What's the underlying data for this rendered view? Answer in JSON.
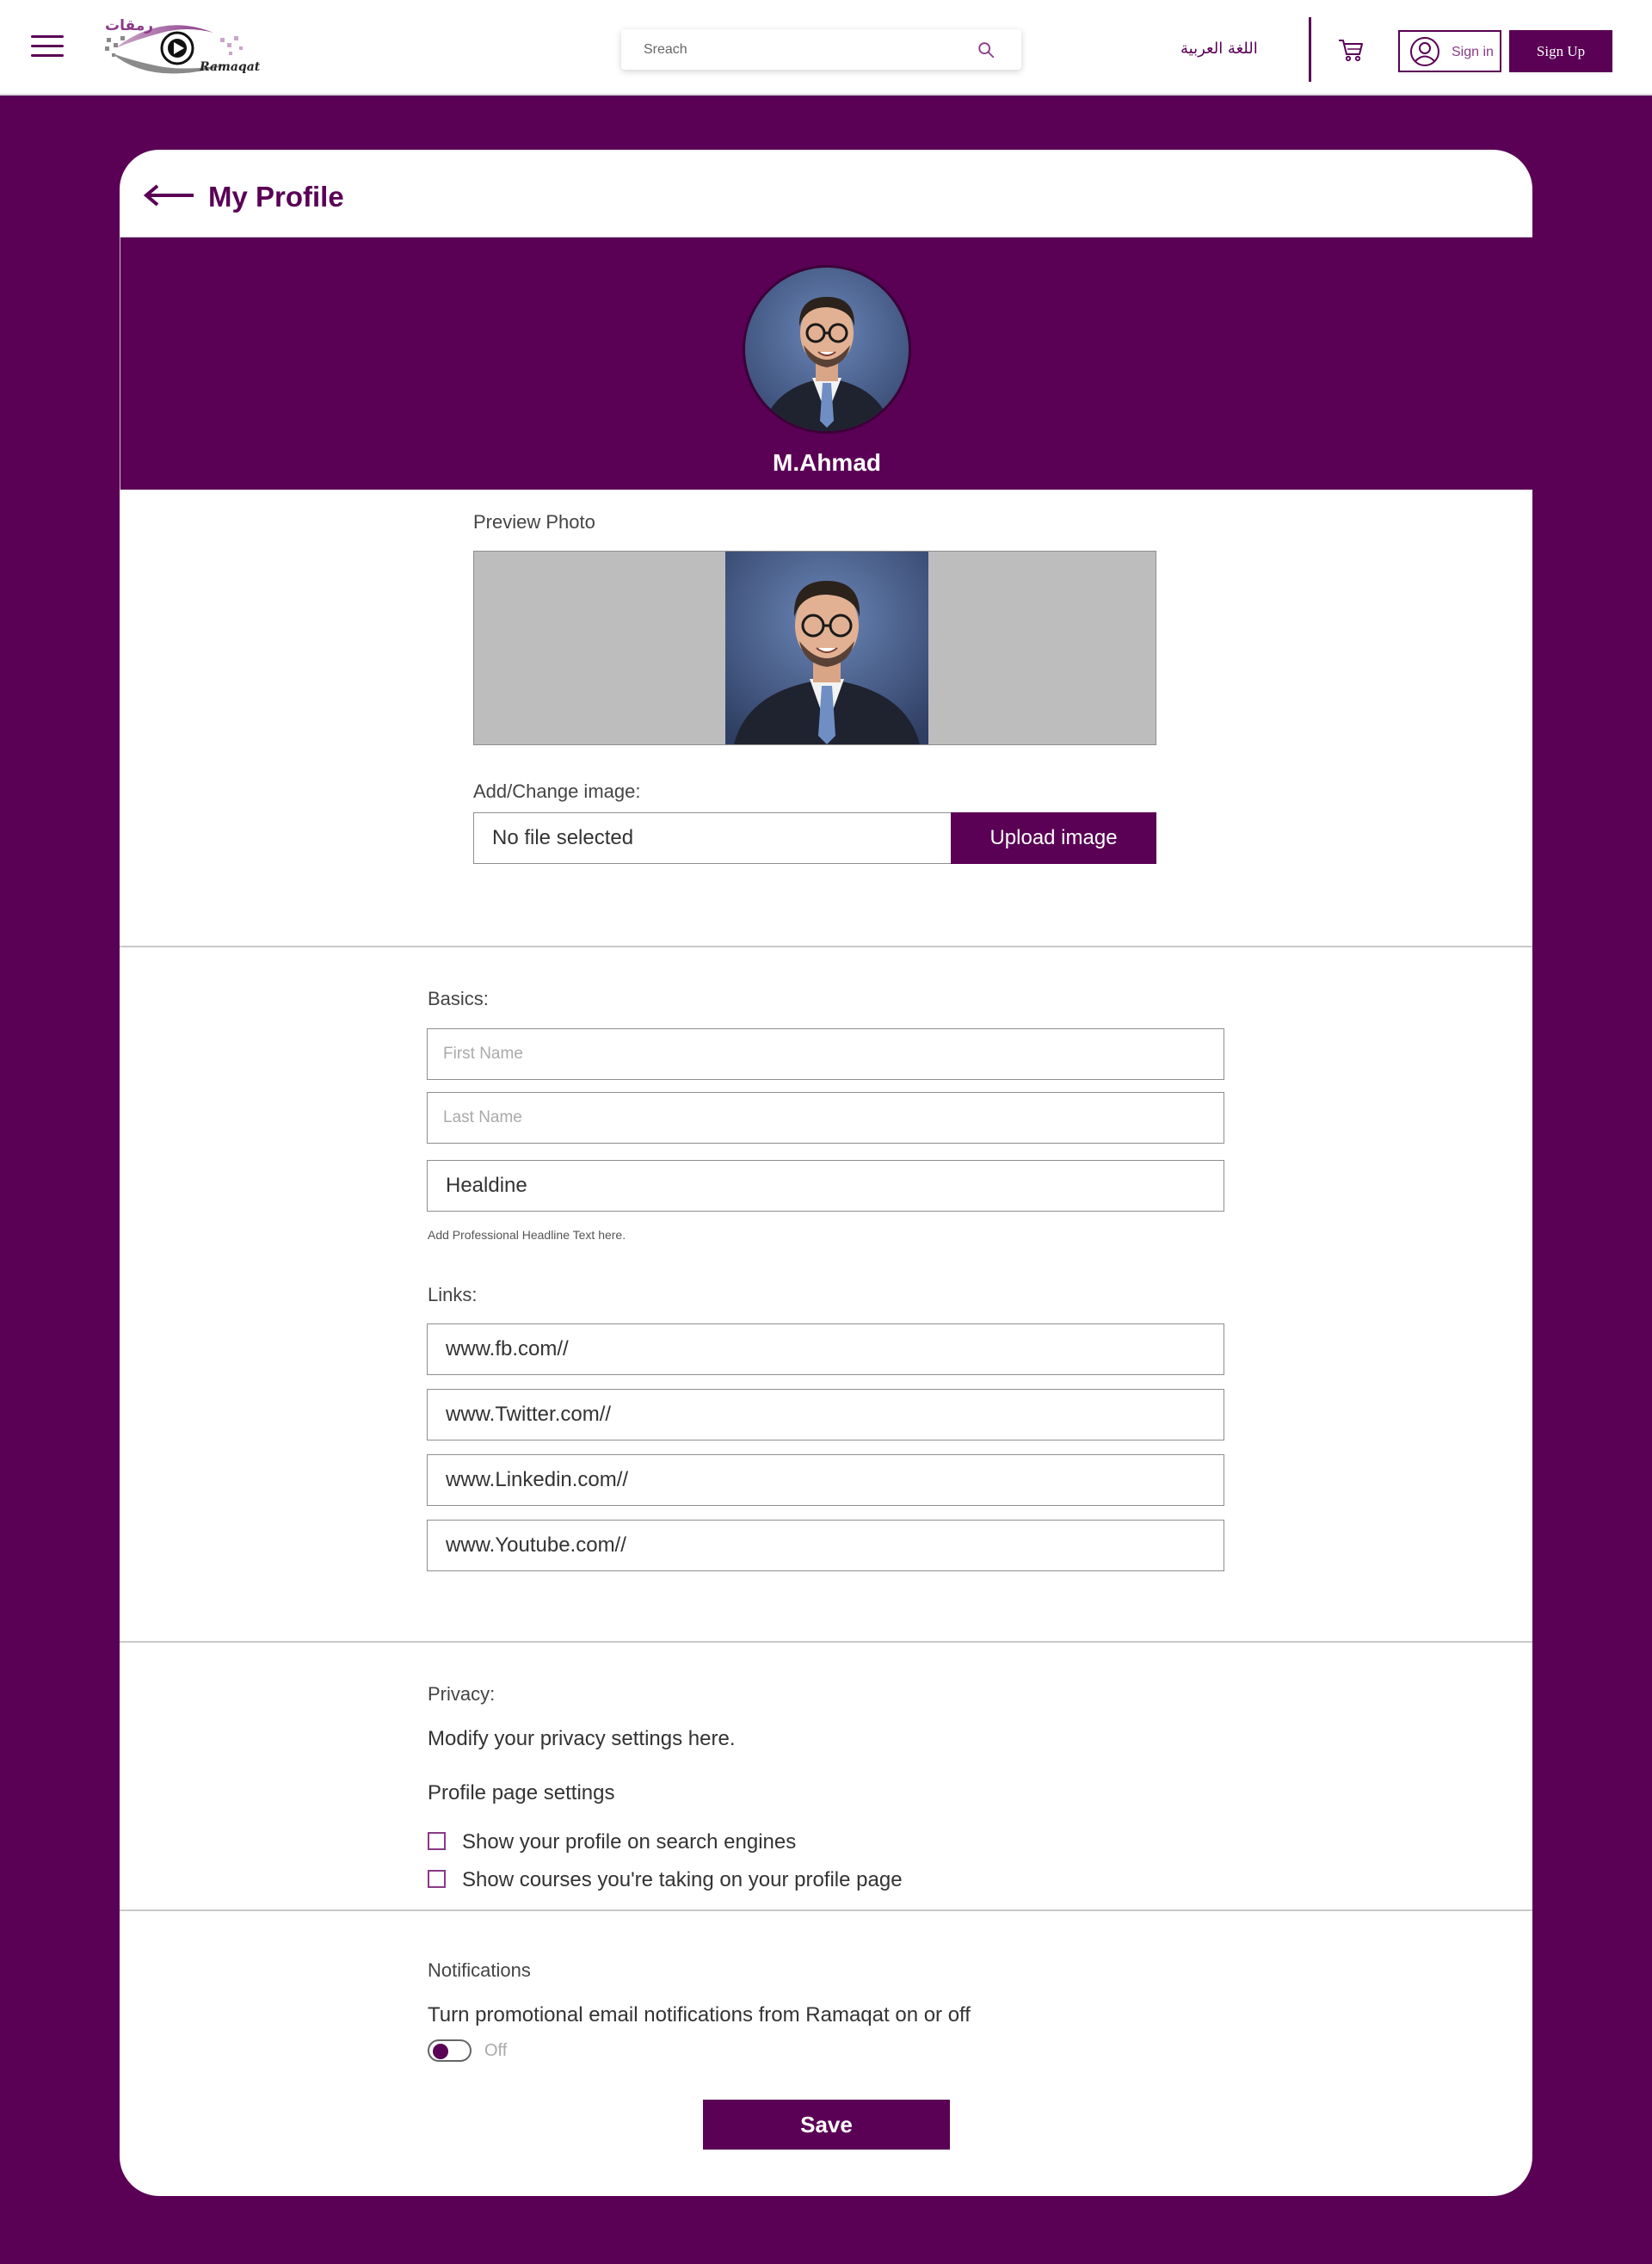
{
  "header": {
    "logo": {
      "arabic": "رمقات",
      "english": "Ramaqat"
    },
    "search": {
      "placeholder": "Sreach"
    },
    "language_label": "اللغة العربية",
    "signin_label": "Sign in",
    "signup_label": "Sign Up"
  },
  "profile": {
    "title": "My Profile",
    "name": "M.Ahmad"
  },
  "photo": {
    "preview_label": "Preview Photo",
    "change_label": "Add/Change image:",
    "file_status": "No file selected",
    "upload_label": "Upload image"
  },
  "basics": {
    "label": "Basics:",
    "first_name_placeholder": "First Name",
    "last_name_placeholder": "Last Name",
    "headline_value": "Healdine",
    "headline_hint": "Add Professional Headline Text here."
  },
  "links": {
    "label": "Links:",
    "items": [
      "www.fb.com//",
      "www.Twitter.com//",
      "www.Linkedin.com//",
      "www.Youtube.com//"
    ]
  },
  "privacy": {
    "label": "Privacy:",
    "description": "Modify your privacy settings here.",
    "settings_title": "Profile page settings",
    "options": [
      {
        "label": "Show your profile on search engines",
        "checked": false
      },
      {
        "label": "Show courses you're taking on your profile page",
        "checked": false
      }
    ]
  },
  "notifications": {
    "label": "Notifications",
    "description": "Turn promotional email notifications from Ramaqat on or off",
    "toggle_state": "Off"
  },
  "actions": {
    "save_label": "Save"
  },
  "colors": {
    "brand": "#5a0055",
    "accent": "#8a3a88",
    "preview_bg": "#bdbdbd"
  }
}
